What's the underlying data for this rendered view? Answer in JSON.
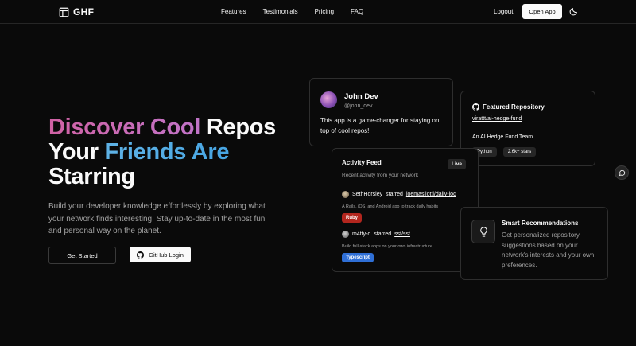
{
  "nav": {
    "logo_text": "GHF",
    "links": [
      "Features",
      "Testimonials",
      "Pricing",
      "FAQ"
    ],
    "logout_label": "Logout",
    "open_app_label": "Open App",
    "theme_icon": "moon-icon"
  },
  "hero": {
    "title_part1": "Discover Cool",
    "title_part2": " Repos",
    "title_part3": "Your ",
    "title_part4": "Friends Are",
    "title_part5": "Starring",
    "description": "Build your developer knowledge effortlessly by exploring what your network finds interesting. Stay up-to-date in the most fun and personal way on the planet.",
    "get_started_label": "Get Started",
    "github_login_label": "GitHub Login"
  },
  "testimonial": {
    "name": "John Dev",
    "handle": "@john_dev",
    "quote": "This app is a game-changer for staying on top of cool repos!"
  },
  "featured_repo": {
    "heading": "Featured Repository",
    "repo": "virattt/ai-hedge-fund",
    "description": "An AI Hedge Fund Team",
    "language": "Python",
    "stars": "2.6k+ stars"
  },
  "activity_feed": {
    "title": "Activity Feed",
    "badge": "Live",
    "subtitle": "Recent activity from your network",
    "items": [
      {
        "user": "SethHorsley",
        "action": "starred",
        "repo": "joemasilotti/daily-log",
        "description": "A Rails, iOS, and Android app to track daily habits",
        "language": "Ruby"
      },
      {
        "user": "m4tty-d",
        "action": "starred",
        "repo": "sst/sst",
        "description": "Build full-stack apps on your own infrastructure.",
        "language": "Typescript"
      }
    ]
  },
  "smart_recommendations": {
    "title": "Smart Recommendations",
    "description": "Get personalized repository suggestions based on your network's interests and your own preferences."
  },
  "colors": {
    "background": "#0a0a0a",
    "gradient_pink": "#d062a4",
    "gradient_blue": "#5fb3e6",
    "ruby": "#b3261e",
    "typescript": "#2f6fd6"
  }
}
